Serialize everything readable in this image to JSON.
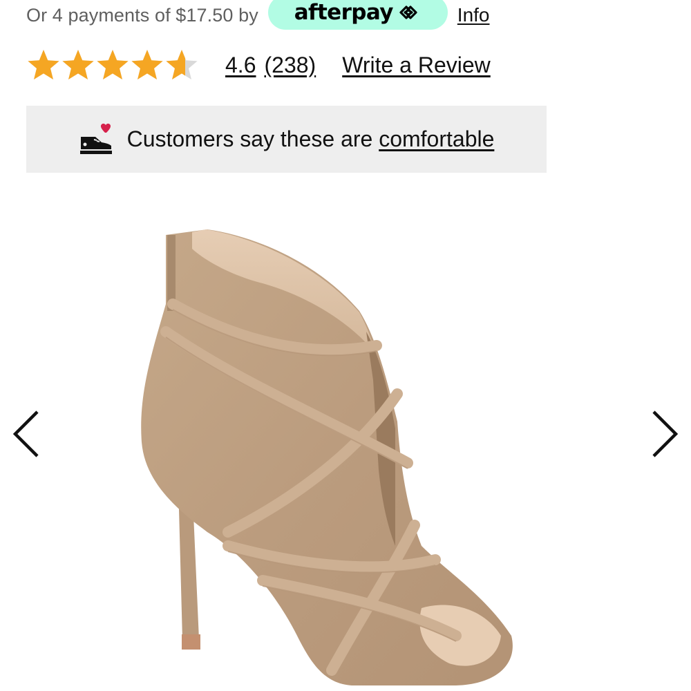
{
  "payment": {
    "text": "Or 4 payments of $17.50 by",
    "provider": "afterpay",
    "provider_color": "#b2fce4",
    "info_label": "Info"
  },
  "rating": {
    "stars_value": 4.6,
    "stars_max": 5,
    "star_color": "#f5a623",
    "value_label": "4.6",
    "count_label": "(238)",
    "write_review_label": "Write a Review"
  },
  "comfort": {
    "icon": "shoe-heart-icon",
    "text": "Customers say these are ",
    "link_label": "comfortable"
  },
  "carousel": {
    "prev_icon": "chevron-left-icon",
    "next_icon": "chevron-right-icon",
    "image": "beige-suede-strappy-peep-toe-bootie-heel"
  }
}
